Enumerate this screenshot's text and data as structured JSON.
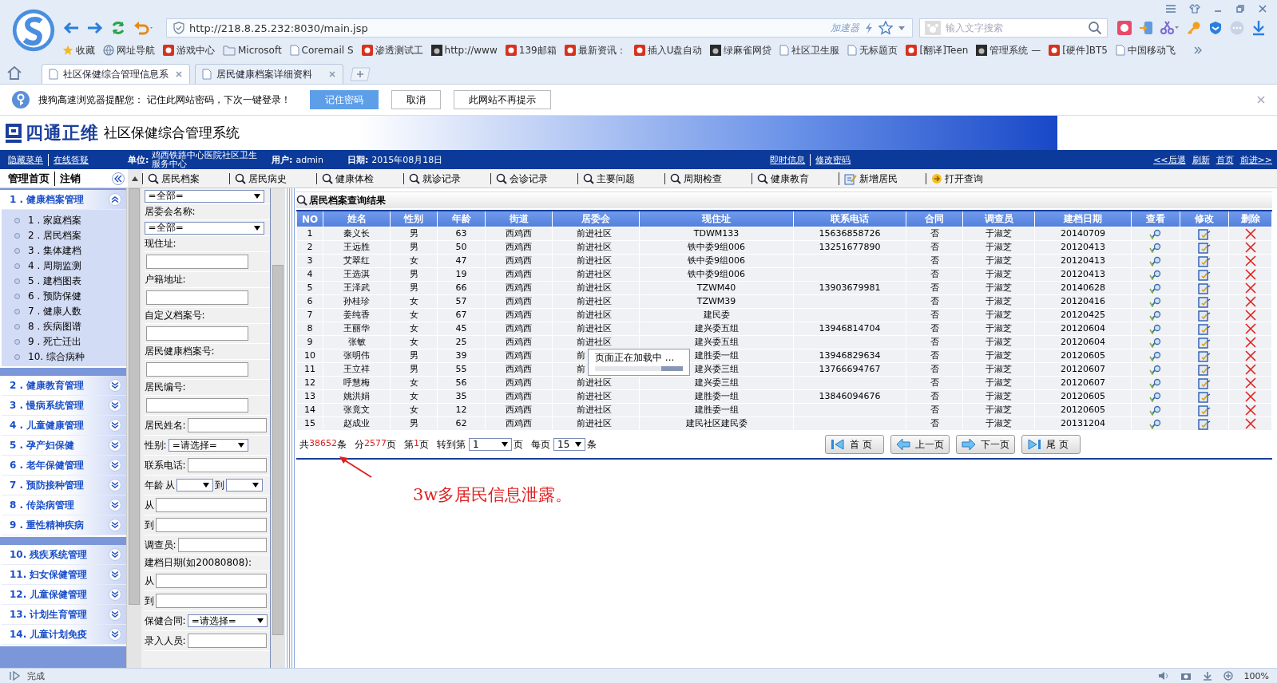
{
  "browser": {
    "address": "http://218.8.25.232:8030/main.jsp",
    "accelerator": "加速器",
    "search": {
      "placeholder": "输入文字搜索"
    },
    "bookmarks": [
      {
        "label": "收藏",
        "kind": "star"
      },
      {
        "label": "网址导航",
        "kind": "globe"
      },
      {
        "label": "游戏中心",
        "kind": "site"
      },
      {
        "label": "Microsoft",
        "kind": "folder"
      },
      {
        "label": "Coremail S",
        "kind": "page"
      },
      {
        "label": "渗透测试工",
        "kind": "site"
      },
      {
        "label": "http://www",
        "kind": "dark"
      },
      {
        "label": "139邮箱",
        "kind": "site"
      },
      {
        "label": "最新资讯：",
        "kind": "site"
      },
      {
        "label": "插入U盘自动",
        "kind": "site"
      },
      {
        "label": "绿麻雀网贷",
        "kind": "dark"
      },
      {
        "label": "社区卫生服",
        "kind": "page"
      },
      {
        "label": "无标题页",
        "kind": "page"
      },
      {
        "label": "[翻译]Teen",
        "kind": "site"
      },
      {
        "label": "管理系统 —",
        "kind": "dark"
      },
      {
        "label": "[硬件]BT5",
        "kind": "site"
      },
      {
        "label": "中国移动飞",
        "kind": "page"
      }
    ],
    "tabs": [
      {
        "label": "社区保健综合管理信息系",
        "selected": true
      },
      {
        "label": "居民健康档案详细资料",
        "selected": false
      }
    ],
    "notice": {
      "text": "搜狗高速浏览器提醒您： 记住此网站密码，下次一键登录！",
      "buttons": [
        {
          "label": "记住密码",
          "primary": true
        },
        {
          "label": "取消",
          "primary": false
        },
        {
          "label": "此网站不再提示",
          "primary": false
        }
      ]
    }
  },
  "app": {
    "logo": "四通正维",
    "title": "社区保健综合管理系统",
    "nav": {
      "left_links": [
        "隐藏菜单",
        "在线答疑"
      ],
      "info": [
        {
          "label": "单位:",
          "value": "鸡西铁路中心医院社区卫生服务中心"
        },
        {
          "label": "用户:",
          "value": "admin"
        },
        {
          "label": "日期:",
          "value": "2015年08月18日"
        }
      ],
      "center_links": [
        "即时信息",
        "修改密码"
      ],
      "right_links": [
        "<<后退",
        "刷新",
        "首页",
        "前进>>"
      ]
    },
    "sidebar_head": [
      "管理首页",
      "注销"
    ],
    "toolbar": [
      {
        "label": "居民档案",
        "kind": "search"
      },
      {
        "label": "居民病史",
        "kind": "search"
      },
      {
        "label": "健康体检",
        "kind": "search"
      },
      {
        "label": "就诊记录",
        "kind": "search"
      },
      {
        "label": "会诊记录",
        "kind": "search"
      },
      {
        "label": "主要问题",
        "kind": "search"
      },
      {
        "label": "周期检查",
        "kind": "search"
      },
      {
        "label": "健康教育",
        "kind": "search"
      },
      {
        "label": "新增居民",
        "kind": "add"
      },
      {
        "label": "打开查询",
        "kind": "open"
      }
    ],
    "sidebar": [
      {
        "groups": [
          {
            "title": "1 . 健康档案管理",
            "expanded": true,
            "items": [
              "1 . 家庭档案",
              "2 . 居民档案",
              "3 . 集体建档",
              "4 . 周期监测",
              "5 . 建档图表",
              "6 . 预防保健",
              "7 . 健康人数",
              "8 . 疾病图谱",
              "9 . 死亡迁出",
              "10. 综合病种"
            ]
          }
        ]
      },
      {
        "groups": [
          {
            "title": "2 . 健康教育管理",
            "expanded": false
          },
          {
            "title": "3 . 慢病系统管理",
            "expanded": false
          },
          {
            "title": "4 . 儿童健康管理",
            "expanded": false
          },
          {
            "title": "5 . 孕产妇保健",
            "expanded": false
          },
          {
            "title": "6 . 老年保健管理",
            "expanded": false
          },
          {
            "title": "7 . 预防接种管理",
            "expanded": false
          },
          {
            "title": "8 . 传染病管理",
            "expanded": false
          },
          {
            "title": "9 . 重性精神疾病",
            "expanded": false
          }
        ]
      },
      {
        "groups": [
          {
            "title": "10. 残疾系统管理",
            "expanded": false
          },
          {
            "title": "11. 妇女保健管理",
            "expanded": false
          },
          {
            "title": "12. 儿童保健管理",
            "expanded": false
          },
          {
            "title": "13. 计划生育管理",
            "expanded": false
          },
          {
            "title": "14. 儿童计划免疫",
            "expanded": false
          }
        ]
      }
    ],
    "filters": [
      {
        "kind": "select",
        "value": "=全部="
      },
      {
        "kind": "label",
        "label": "居委会名称:"
      },
      {
        "kind": "select",
        "value": "=全部="
      },
      {
        "kind": "label",
        "label": "现住址:"
      },
      {
        "kind": "input"
      },
      {
        "kind": "label",
        "label": "户籍地址:"
      },
      {
        "kind": "input"
      },
      {
        "kind": "label",
        "label": "自定义档案号:"
      },
      {
        "kind": "input"
      },
      {
        "kind": "label",
        "label": "居民健康档案号:"
      },
      {
        "kind": "input"
      },
      {
        "kind": "label",
        "label": "居民编号:"
      },
      {
        "kind": "input"
      },
      {
        "kind": "inline_input",
        "label": "居民姓名:"
      },
      {
        "kind": "inline_select",
        "label": "性别:",
        "value": "=请选择="
      },
      {
        "kind": "inline_input",
        "label": "联系电话:"
      },
      {
        "kind": "range",
        "label": "年龄",
        "from": "从",
        "to": "到"
      },
      {
        "kind": "inline_input",
        "label": "从"
      },
      {
        "kind": "inline_input",
        "label": "到"
      },
      {
        "kind": "inline_input",
        "label": "调查员:"
      },
      {
        "kind": "label",
        "label": "建档日期(如20080808):"
      },
      {
        "kind": "inline_input",
        "label": "从"
      },
      {
        "kind": "inline_input",
        "label": "到"
      },
      {
        "kind": "inline_select",
        "label": "保健合同:",
        "value": "=请选择="
      },
      {
        "kind": "inline_input",
        "label": "录入人员:"
      }
    ],
    "results": {
      "title": "居民档案查询结果",
      "columns": [
        "NO",
        "姓名",
        "性别",
        "年龄",
        "街道",
        "居委会",
        "现住址",
        "联系电话",
        "合同",
        "调查员",
        "建档日期",
        "查看",
        "修改",
        "删除"
      ],
      "rows": [
        {
          "no": "1",
          "name": "秦义长",
          "sex": "男",
          "age": "63",
          "street": "西鸡西",
          "committee": "前进社区",
          "address": "TDWM133",
          "phone": "15636858726",
          "contract": "否",
          "surveyor": "于淑芝",
          "date": "20140709"
        },
        {
          "no": "2",
          "name": "王远胜",
          "sex": "男",
          "age": "50",
          "street": "西鸡西",
          "committee": "前进社区",
          "address": "铁中委9组006",
          "phone": "13251677890",
          "contract": "否",
          "surveyor": "于淑芝",
          "date": "20120413"
        },
        {
          "no": "3",
          "name": "艾翠红",
          "sex": "女",
          "age": "47",
          "street": "西鸡西",
          "committee": "前进社区",
          "address": "铁中委9组006",
          "contract": "否",
          "surveyor": "于淑芝",
          "date": "20120413"
        },
        {
          "no": "4",
          "name": "王选淇",
          "sex": "男",
          "age": "19",
          "street": "西鸡西",
          "committee": "前进社区",
          "address": "铁中委9组006",
          "contract": "否",
          "surveyor": "于淑芝",
          "date": "20120413"
        },
        {
          "no": "5",
          "name": "王泽武",
          "sex": "男",
          "age": "66",
          "street": "西鸡西",
          "committee": "前进社区",
          "address": "TZWM40",
          "phone": "13903679981",
          "contract": "否",
          "surveyor": "于淑芝",
          "date": "20140628"
        },
        {
          "no": "6",
          "name": "孙桂珍",
          "sex": "女",
          "age": "57",
          "street": "西鸡西",
          "committee": "前进社区",
          "address": "TZWM39",
          "contract": "否",
          "surveyor": "于淑芝",
          "date": "20120416"
        },
        {
          "no": "7",
          "name": "姜纯香",
          "sex": "女",
          "age": "67",
          "street": "西鸡西",
          "committee": "前进社区",
          "address": "建民委",
          "contract": "否",
          "surveyor": "于淑芝",
          "date": "20120425"
        },
        {
          "no": "8",
          "name": "王丽华",
          "sex": "女",
          "age": "45",
          "street": "西鸡西",
          "committee": "前进社区",
          "address": "建兴委五组",
          "phone": "13946814704",
          "contract": "否",
          "surveyor": "于淑芝",
          "date": "20120604"
        },
        {
          "no": "9",
          "name": "张敏",
          "sex": "女",
          "age": "25",
          "street": "西鸡西",
          "committee": "前进社区",
          "address": "建兴委五组",
          "contract": "否",
          "surveyor": "于淑芝",
          "date": "20120604"
        },
        {
          "no": "10",
          "name": "张明伟",
          "sex": "男",
          "age": "39",
          "street": "西鸡西",
          "committee": "前",
          "address": "建胜委一组",
          "phone": "13946829634",
          "contract": "否",
          "surveyor": "于淑芝",
          "date": "20120605"
        },
        {
          "no": "11",
          "name": "王立祥",
          "sex": "男",
          "age": "55",
          "street": "西鸡西",
          "committee": "前",
          "address": "建兴委三组",
          "phone": "13766694767",
          "contract": "否",
          "surveyor": "于淑芝",
          "date": "20120607"
        },
        {
          "no": "12",
          "name": "呼慧梅",
          "sex": "女",
          "age": "56",
          "street": "西鸡西",
          "committee": "前进社区",
          "address": "建兴委三组",
          "contract": "否",
          "surveyor": "于淑芝",
          "date": "20120607"
        },
        {
          "no": "13",
          "name": "姚洪娟",
          "sex": "女",
          "age": "35",
          "street": "西鸡西",
          "committee": "前进社区",
          "address": "建胜委一组",
          "phone": "13846094676",
          "contract": "否",
          "surveyor": "于淑芝",
          "date": "20120605"
        },
        {
          "no": "14",
          "name": "张竟文",
          "sex": "女",
          "age": "12",
          "street": "西鸡西",
          "committee": "前进社区",
          "address": "建胜委一组",
          "contract": "否",
          "surveyor": "于淑芝",
          "date": "20120605"
        },
        {
          "no": "15",
          "name": "赵成业",
          "sex": "男",
          "age": "62",
          "street": "西鸡西",
          "committee": "前进社区",
          "address": "建民社区建民委",
          "contract": "否",
          "surveyor": "于淑芝",
          "date": "20131204"
        }
      ],
      "loading": {
        "text": "页面正在加载中 ...",
        "level": 0.25
      },
      "summary": [
        {
          "text": "共",
          "highlight": false
        },
        {
          "text": "38652",
          "highlight": true
        },
        {
          "text": "条",
          "highlight": false
        },
        {
          "text": "分",
          "highlight": false
        },
        {
          "text": "2577",
          "highlight": true
        },
        {
          "text": "页",
          "highlight": false
        },
        {
          "text": "第",
          "highlight": false
        },
        {
          "text": "1",
          "highlight": true
        },
        {
          "text": "页",
          "highlight": false
        }
      ],
      "goto": {
        "label": "转到第",
        "value": "1",
        "unit": "页"
      },
      "per_page": {
        "label": "每页",
        "value": "15",
        "unit": "条"
      },
      "buttons": [
        {
          "label": "首 页",
          "kind": "first"
        },
        {
          "label": "上一页",
          "kind": "prev"
        },
        {
          "label": "下一页",
          "kind": "next"
        },
        {
          "label": "尾 页",
          "kind": "last"
        }
      ]
    },
    "annotation": "3w多居民信息泄露。"
  },
  "status_bar": {
    "text": "完成",
    "zoom": "100%"
  }
}
